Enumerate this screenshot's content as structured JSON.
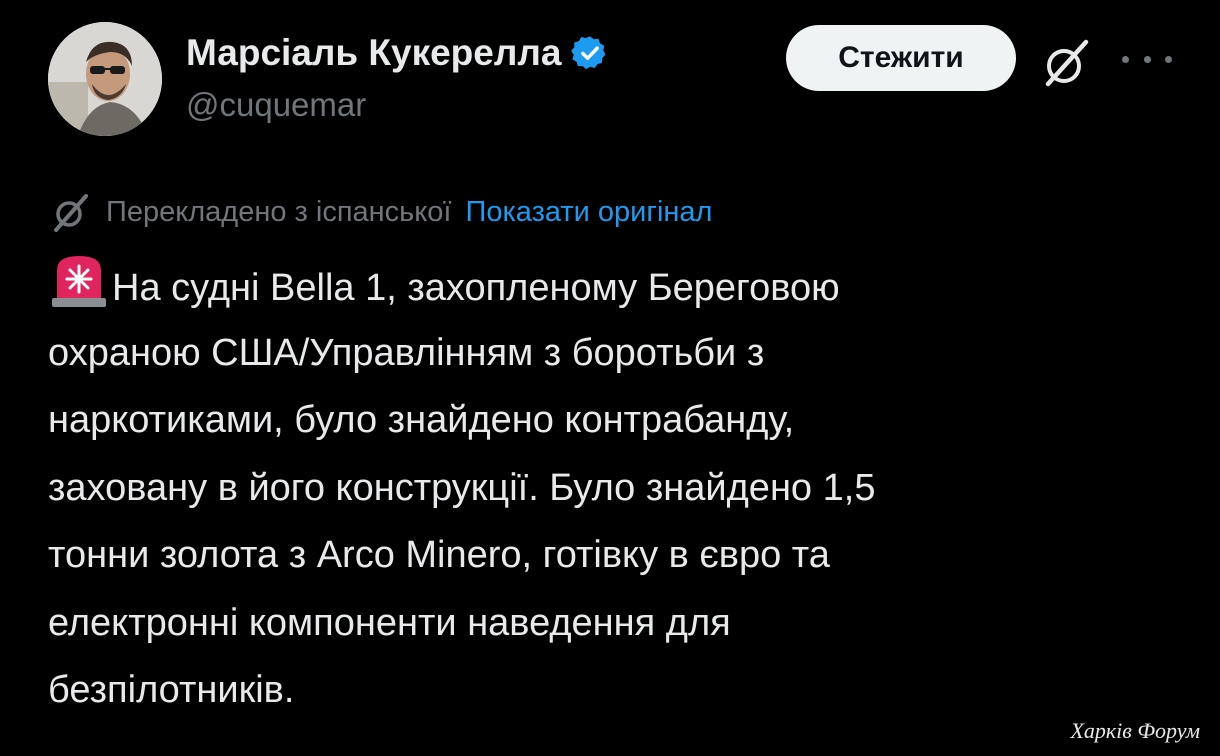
{
  "post": {
    "author": {
      "name": "Марсіаль Кукерелла",
      "handle": "@cuquemar",
      "verified": true,
      "verified_badge_icon": "verified-badge-icon"
    },
    "actions": {
      "follow_label": "Стежити",
      "grok_icon": "grok-icon",
      "more_icon": "more-options-icon"
    },
    "translation": {
      "icon": "translate-icon",
      "translated_label": "Перекладено з іспанської",
      "show_original_label": "Показати оригінал"
    },
    "text": {
      "leading_emoji": "rotating-light-siren-icon",
      "lines": [
        "На судні Bella 1, захопленому Береговою",
        "охраною США/Управлінням з боротьби з",
        "наркотиками, було знайдено контрабанду,",
        "заховану в його конструкції. Було знайдено 1,5",
        "тонни золота з Arco Minero, готівку в євро та",
        "електронні компоненти наведення для",
        "безпілотників."
      ]
    }
  },
  "watermark": "Харків Форум",
  "colors": {
    "background": "#000000",
    "text": "#e7e9ea",
    "secondary_text": "#71767b",
    "link": "#1d9bf0",
    "verified_badge": "#1d9bf0",
    "follow_button_bg": "#eff3f4",
    "follow_button_text": "#0f1419"
  }
}
